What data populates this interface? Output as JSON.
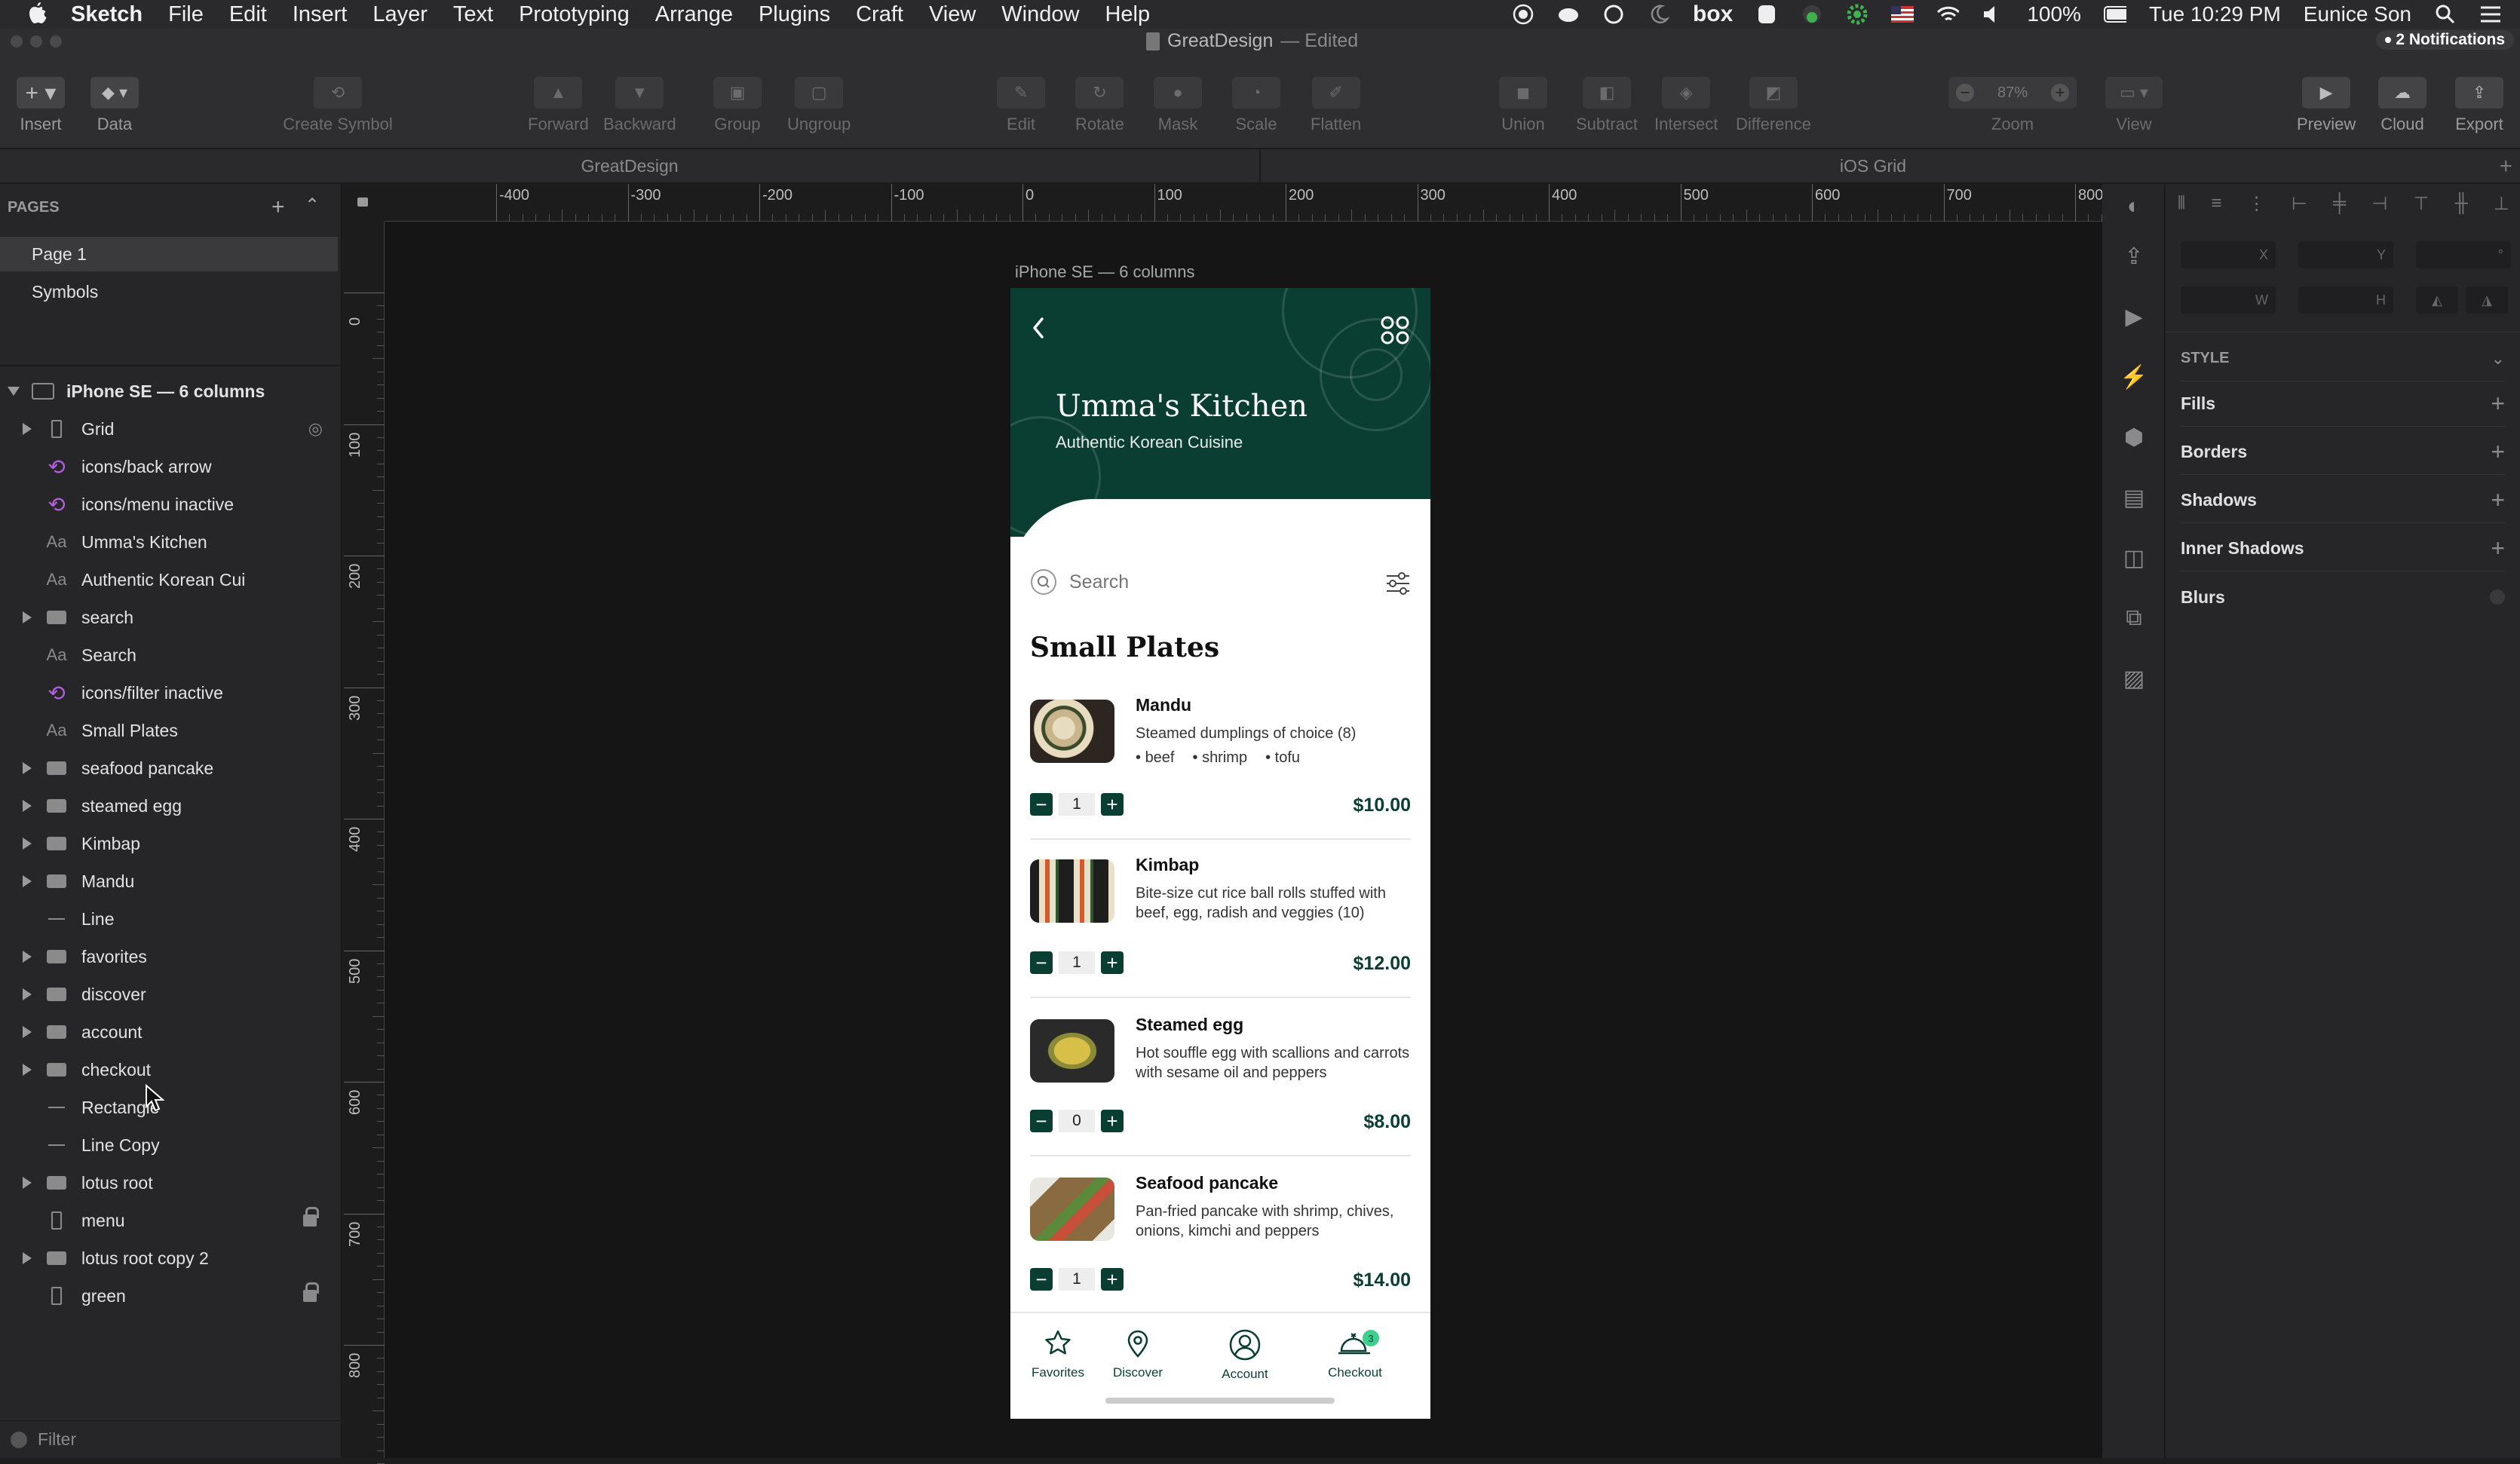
{
  "menubar": {
    "app": "Sketch",
    "items": [
      "File",
      "Edit",
      "Insert",
      "Layer",
      "Text",
      "Prototyping",
      "Arrange",
      "Plugins",
      "Craft",
      "View",
      "Window",
      "Help"
    ],
    "box_label": "box",
    "battery": "100%",
    "clock": "Tue 10:29 PM",
    "user": "Eunice Son"
  },
  "titlebar": {
    "doc": "GreatDesign",
    "status": "— Edited",
    "notifications": "2 Notifications"
  },
  "toolbar": {
    "insert": "Insert",
    "data": "Data",
    "create_symbol": "Create Symbol",
    "forward": "Forward",
    "backward": "Backward",
    "group": "Group",
    "ungroup": "Ungroup",
    "edit": "Edit",
    "rotate": "Rotate",
    "mask": "Mask",
    "scale": "Scale",
    "flatten": "Flatten",
    "union": "Union",
    "subtract": "Subtract",
    "intersect": "Intersect",
    "difference": "Difference",
    "zoom_label": "Zoom",
    "zoom_value": "87%",
    "view": "View",
    "preview": "Preview",
    "cloud": "Cloud",
    "export": "Export"
  },
  "docbar": {
    "left_tab": "GreatDesign",
    "right_tab": "iOS Grid"
  },
  "pages": {
    "header": "PAGES",
    "items": [
      "Page 1",
      "Symbols"
    ]
  },
  "layers": {
    "artboard": "iPhone SE — 6 columns",
    "items": [
      {
        "name": "Grid",
        "kind": "rect"
      },
      {
        "name": "icons/back arrow",
        "kind": "symbol"
      },
      {
        "name": "icons/menu inactive",
        "kind": "symbol"
      },
      {
        "name": "Umma's Kitchen",
        "kind": "text"
      },
      {
        "name": "Authentic Korean Cui",
        "kind": "text"
      },
      {
        "name": "search",
        "kind": "folder"
      },
      {
        "name": "Search",
        "kind": "text"
      },
      {
        "name": "icons/filter inactive",
        "kind": "symbol"
      },
      {
        "name": "Small Plates",
        "kind": "text"
      },
      {
        "name": "seafood pancake",
        "kind": "folder"
      },
      {
        "name": "steamed egg",
        "kind": "folder"
      },
      {
        "name": "Kimbap",
        "kind": "folder"
      },
      {
        "name": "Mandu",
        "kind": "folder"
      },
      {
        "name": "Line",
        "kind": "line"
      },
      {
        "name": "favorites",
        "kind": "folder"
      },
      {
        "name": "discover",
        "kind": "folder"
      },
      {
        "name": "account",
        "kind": "folder"
      },
      {
        "name": "checkout",
        "kind": "folder"
      },
      {
        "name": "Rectangle",
        "kind": "line"
      },
      {
        "name": "Line Copy",
        "kind": "line"
      },
      {
        "name": "lotus root",
        "kind": "folder"
      },
      {
        "name": "menu",
        "kind": "rect"
      },
      {
        "name": "lotus root copy 2",
        "kind": "folder"
      },
      {
        "name": "green",
        "kind": "rect"
      }
    ],
    "filter": "Filter"
  },
  "ruler": {
    "top": [
      "-400",
      "-300",
      "-200",
      "-100",
      "0",
      "100",
      "200",
      "300",
      "400",
      "500",
      "600",
      "700",
      "800"
    ],
    "left": [
      "0",
      "100",
      "200",
      "300",
      "400",
      "500",
      "600",
      "700",
      "800"
    ]
  },
  "inspector": {
    "x": "X",
    "y": "Y",
    "rot": "°",
    "w": "W",
    "h": "H",
    "style": "STYLE",
    "sections": [
      "Fills",
      "Borders",
      "Shadows",
      "Inner Shadows",
      "Blurs"
    ]
  },
  "artboard": {
    "label": "iPhone SE — 6 columns",
    "title": "Umma's Kitchen",
    "subtitle": "Authentic Korean Cuisine",
    "search_placeholder": "Search",
    "section": "Small Plates",
    "products": [
      {
        "name": "Mandu",
        "desc": "Steamed dumplings of choice (8)",
        "options": [
          "beef",
          "shrimp",
          "tofu"
        ],
        "qty": "1",
        "price": "$10.00"
      },
      {
        "name": "Kimbap",
        "desc": "Bite-size cut rice ball rolls stuffed with beef, egg, radish and veggies (10)",
        "qty": "1",
        "price": "$12.00"
      },
      {
        "name": "Steamed egg",
        "desc": "Hot souffle egg with scallions and carrots with sesame oil and peppers",
        "qty": "0",
        "price": "$8.00"
      },
      {
        "name": "Seafood pancake",
        "desc": "Pan-fried pancake with shrimp, chives, onions, kimchi and peppers",
        "qty": "1",
        "price": "$14.00"
      }
    ],
    "nav": [
      "Favorites",
      "Discover",
      "Account",
      "Checkout"
    ],
    "cart_count": "3",
    "colors": {
      "brand": "#0b3e33",
      "accent": "#3ecf8e"
    }
  }
}
